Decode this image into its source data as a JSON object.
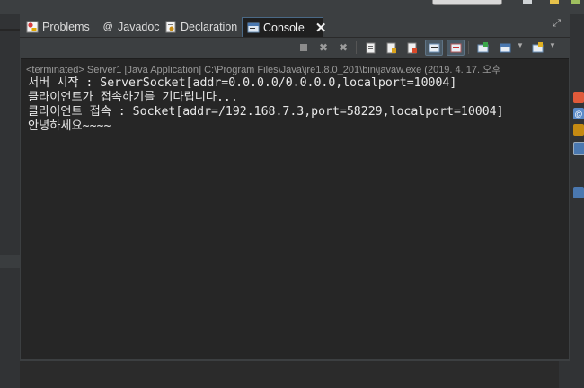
{
  "tabs": [
    {
      "label": "Problems",
      "icon": "problems-icon",
      "active": false
    },
    {
      "label": "Javadoc",
      "icon": "javadoc-icon",
      "active": false
    },
    {
      "label": "Declaration",
      "icon": "declaration-icon",
      "active": false
    },
    {
      "label": "Console",
      "icon": "console-icon",
      "active": true
    }
  ],
  "console": {
    "terminated_line": "<terminated> Server1 [Java Application] C:\\Program Files\\Java\\jre1.8.0_201\\bin\\javaw.exe (2019. 4. 17. 오후",
    "output": [
      "서버 시작 : ServerSocket[addr=0.0.0.0/0.0.0.0,localport=10004]",
      "클라이언트가 접속하기를 기다립니다...",
      "클라이언트 접속 : Socket[addr=/192.168.7.3,port=58229,localport=10004]",
      "안녕하세요~~~~"
    ]
  },
  "toolbar": {
    "buttons": [
      "terminate-icon",
      "remove-launch-icon",
      "remove-all-terminated-icon",
      "clear-console-icon",
      "scroll-lock-icon",
      "word-wrap-icon",
      "show-on-stdout-icon",
      "show-on-stderr-icon",
      "pin-console-icon",
      "display-console-icon",
      "open-console-icon"
    ]
  },
  "colors": {
    "background": "#262626",
    "text": "#e8e8e8",
    "terminated_text": "#9a9a9a",
    "active_tab_border": "#4a6986"
  }
}
